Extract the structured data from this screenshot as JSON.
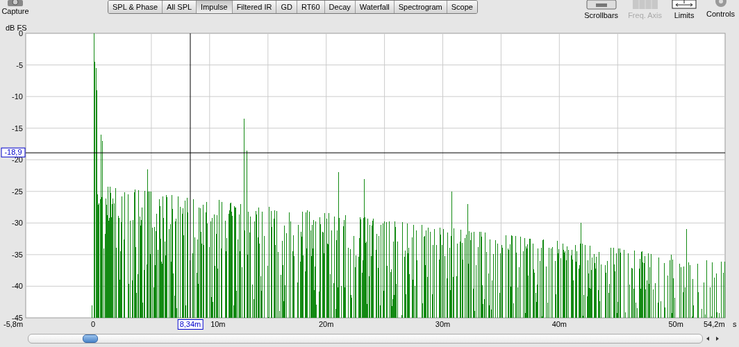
{
  "toolbar": {
    "capture": {
      "label": "Capture"
    },
    "tabs": [
      {
        "label": "SPL & Phase",
        "selected": false
      },
      {
        "label": "All SPL",
        "selected": false
      },
      {
        "label": "Impulse",
        "selected": true
      },
      {
        "label": "Filtered IR",
        "selected": false
      },
      {
        "label": "GD",
        "selected": false
      },
      {
        "label": "RT60",
        "selected": false
      },
      {
        "label": "Decay",
        "selected": false
      },
      {
        "label": "Waterfall",
        "selected": false
      },
      {
        "label": "Spectrogram",
        "selected": false
      },
      {
        "label": "Scope",
        "selected": false
      }
    ],
    "tools": [
      {
        "kind": "scrollbars",
        "label": "Scrollbars",
        "disabled": false
      },
      {
        "kind": "freq",
        "label": "Freq. Axis",
        "disabled": true
      },
      {
        "kind": "limits",
        "label": "Limits",
        "disabled": false
      },
      {
        "kind": "controls",
        "label": "Controls",
        "disabled": false
      }
    ]
  },
  "plot": {
    "y_unit": "dB FS",
    "y_ticks": [
      "0",
      "-5",
      "-10",
      "-15",
      "-20",
      "-25",
      "-30",
      "-35",
      "-40",
      "-45"
    ],
    "x_start": "-5,8m",
    "x_ticks": [
      "0",
      "10m",
      "20m",
      "30m",
      "40m",
      "50m"
    ],
    "x_end": "54,2m",
    "x_unit": "s",
    "cursor": {
      "x_readout": "8,34m",
      "y_readout": "-18,9"
    }
  }
}
